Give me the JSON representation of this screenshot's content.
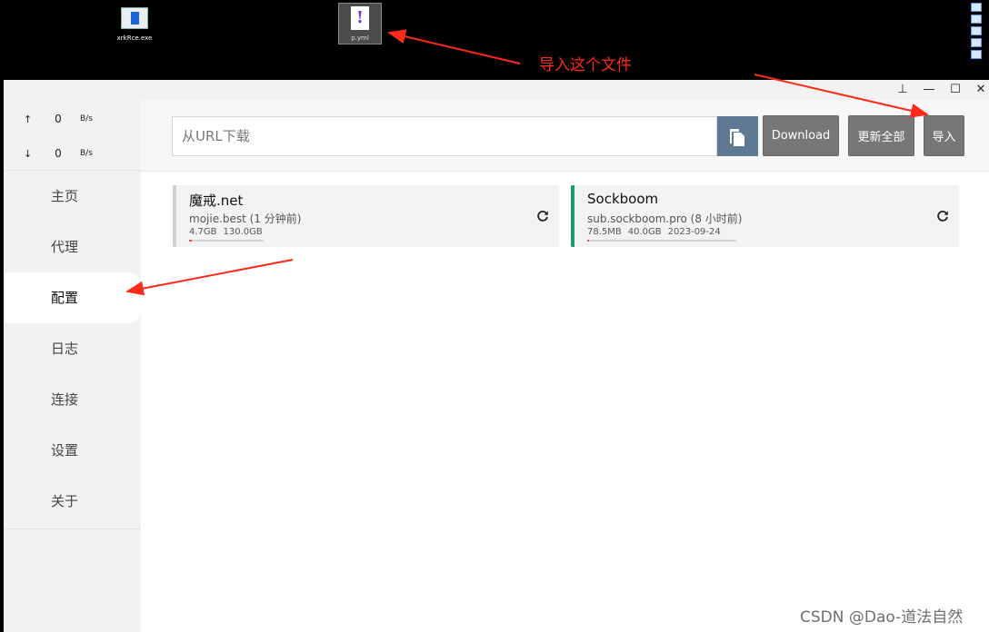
{
  "desktop": {
    "icons": [
      {
        "label": "xrkRce.exe"
      },
      {
        "label": "p.yml"
      }
    ],
    "annotation": "导入这个文件"
  },
  "titlebar": {
    "pin": "⊥",
    "minimize": "—",
    "maximize": "☐",
    "close": "✕"
  },
  "traffic": {
    "up": {
      "arrow": "↑",
      "value": "0",
      "unit": "B/s"
    },
    "down": {
      "arrow": "↓",
      "value": "0",
      "unit": "B/s"
    }
  },
  "nav": [
    {
      "label": "主页",
      "active": false
    },
    {
      "label": "代理",
      "active": false
    },
    {
      "label": "配置",
      "active": true
    },
    {
      "label": "日志",
      "active": false
    },
    {
      "label": "连接",
      "active": false
    },
    {
      "label": "设置",
      "active": false
    },
    {
      "label": "关于",
      "active": false
    }
  ],
  "toolbar": {
    "url_placeholder": "从URL下载",
    "download_label": "Download",
    "update_all_label": "更新全部",
    "import_label": "导入"
  },
  "profiles": [
    {
      "name": "魔戒.net",
      "host": "mojie.best (1 分钟前)",
      "used": "4.7GB",
      "total": "130.0GB",
      "expire": "",
      "usage_fraction": 0.036,
      "accent": "#d0d0d0",
      "selected": false
    },
    {
      "name": "Sockboom",
      "host": "sub.sockboom.pro (8 小时前)",
      "used": "78.5MB",
      "total": "40.0GB",
      "expire": "2023-09-24",
      "usage_fraction": 0.002,
      "accent": "#1c9a6a",
      "selected": true
    }
  ],
  "watermark": "CSDN @Dao-道法自然",
  "colors": {
    "annotation_red": "#ff2a1a",
    "paste_button": "#5e7a93",
    "action_button": "#777777",
    "selected_accent": "#1c9a6a"
  }
}
